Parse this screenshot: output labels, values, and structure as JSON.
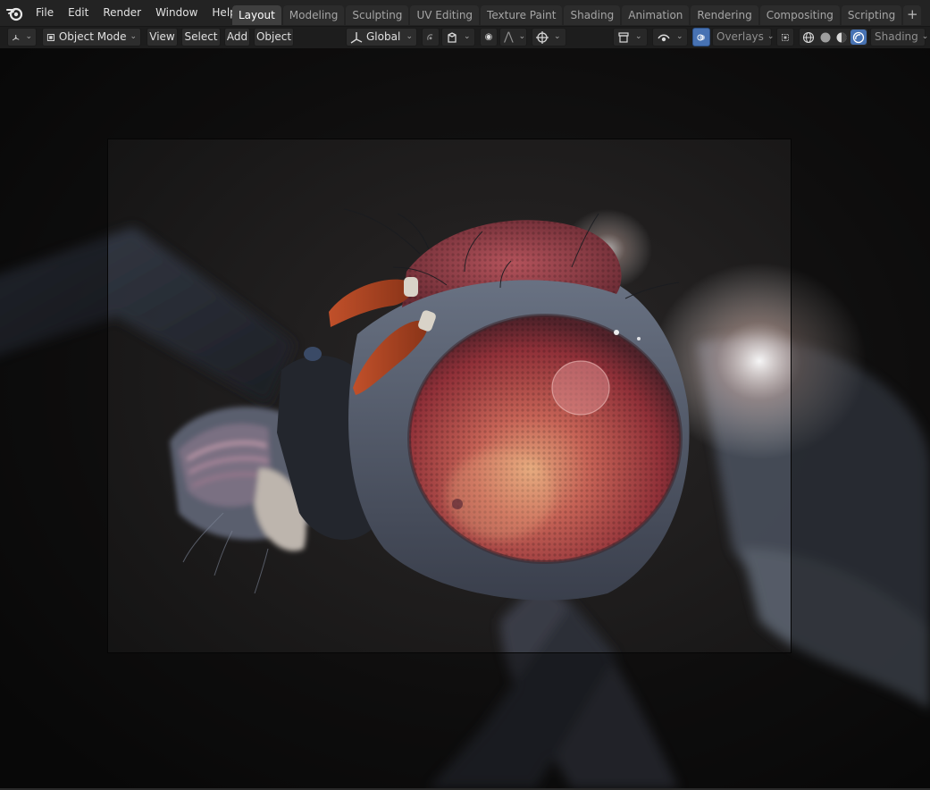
{
  "app": {
    "name": "Blender"
  },
  "menu": [
    "File",
    "Edit",
    "Render",
    "Window",
    "Help"
  ],
  "workspaces": [
    "Layout",
    "Modeling",
    "Sculpting",
    "UV Editing",
    "Texture Paint",
    "Shading",
    "Animation",
    "Rendering",
    "Compositing",
    "Scripting"
  ],
  "active_workspace": "Layout",
  "header": {
    "mode": "Object Mode",
    "view": "View",
    "select": "Select",
    "add": "Add",
    "object": "Object",
    "orientation": "Global",
    "overlays": "Overlays",
    "shading": "Shading"
  },
  "icons": {
    "logo": "blender-logo",
    "editor_type": "3d-viewport-icon",
    "mode": "object-mode-icon",
    "transform": "transform-orientation-icon",
    "pivot": "pivot-point-icon",
    "snap": "snap-icon",
    "proportional": "proportional-editing-icon",
    "visibility": "object-visibility-icon",
    "gizmos": "gizmo-icon",
    "overlays": "overlay-icon",
    "xray": "xray-icon",
    "shading_modes": [
      "wireframe-icon",
      "solid-icon",
      "material-preview-icon",
      "rendered-icon"
    ]
  },
  "colors": {
    "accent": "#4772b3",
    "topbar": "#232323",
    "header": "#1d1d1d",
    "viewport": "#141414",
    "eye": "#b84a4e"
  }
}
